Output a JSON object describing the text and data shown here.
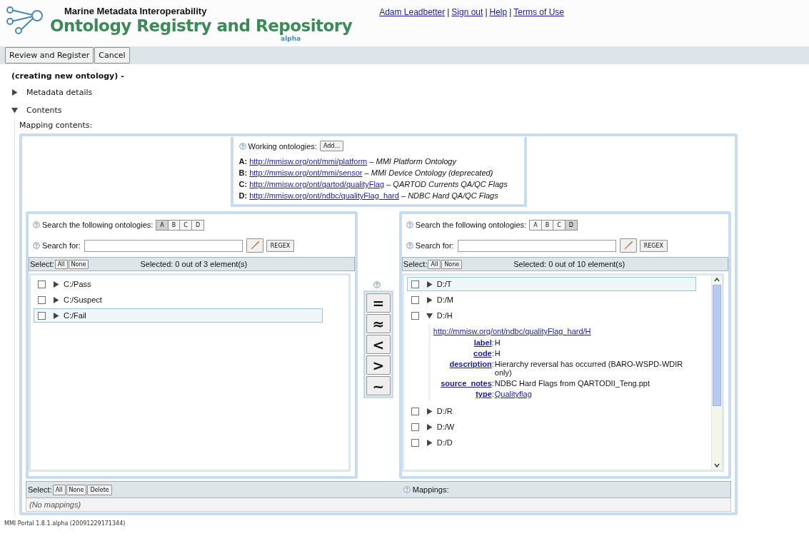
{
  "header": {
    "org": "Marine Metadata Interoperability",
    "title": "Ontology Registry and Repository",
    "badge": "alpha",
    "user_links": [
      "Adam Leadbetter",
      "Sign out",
      "Help",
      "Terms of Use"
    ],
    "link_separator": "|"
  },
  "toolbar": {
    "buttons": [
      "Review and Register",
      "Cancel"
    ]
  },
  "status": "(creating new ontology) -",
  "sections": [
    {
      "label": "Metadata details",
      "expanded": false
    },
    {
      "label": "Contents",
      "expanded": true
    }
  ],
  "mapping_label": "Mapping contents:",
  "working": {
    "label": "Working ontologies:",
    "add_button": "Add...",
    "dash": "–",
    "items": [
      {
        "letter": "A:",
        "url": "http://mmisw.org/ont/mmi/platform",
        "name": "MMI Platform Ontology"
      },
      {
        "letter": "B:",
        "url": "http://mmisw.org/ont/mmi/sensor",
        "name": "MMI Device Ontology (deprecated)"
      },
      {
        "letter": "C:",
        "url": "http://mmisw.org/ont/qartod/qualityFlag",
        "name": "QARTOD Currents QA/QC Flags"
      },
      {
        "letter": "D:",
        "url": "http://mmisw.org/ont/ndbc/qualityFlag_hard",
        "name": "NDBC Hard QA/QC Flags"
      }
    ]
  },
  "panels": [
    {
      "search_label": "Search the following ontologies:",
      "ontologies": [
        {
          "label": "A",
          "selected": true
        },
        {
          "label": "B",
          "selected": false
        },
        {
          "label": "C",
          "selected": false
        },
        {
          "label": "D",
          "selected": false
        }
      ],
      "search_for": "Search for:",
      "regex": "REGEX",
      "select_label": "Select:",
      "all": "All",
      "none": "None",
      "selected_text": "Selected: 0 out of 3 element(s)",
      "scrollbar": false,
      "rows": [
        {
          "label": "C:/Pass",
          "checked": false,
          "expanded": false,
          "highlighted": false
        },
        {
          "label": "C:/Suspect",
          "checked": false,
          "expanded": false,
          "highlighted": false
        },
        {
          "label": "C:/Fail",
          "checked": false,
          "expanded": false,
          "highlighted": true
        }
      ]
    },
    {
      "search_label": "Search the following ontologies:",
      "ontologies": [
        {
          "label": "A",
          "selected": false
        },
        {
          "label": "B",
          "selected": false
        },
        {
          "label": "C",
          "selected": false
        },
        {
          "label": "D",
          "selected": true
        }
      ],
      "search_for": "Search for:",
      "regex": "REGEX",
      "select_label": "Select:",
      "all": "All",
      "none": "None",
      "selected_text": "Selected: 0 out of 10 element(s)",
      "scrollbar": true,
      "rows": [
        {
          "label": "D:/T",
          "checked": false,
          "expanded": false,
          "highlighted": true
        },
        {
          "label": "D:/M",
          "checked": false,
          "expanded": false,
          "highlighted": false
        },
        {
          "label": "D:/H",
          "checked": false,
          "expanded": true,
          "highlighted": false,
          "details": {
            "colon": ":",
            "uri": "http://mmisw.org/ont/ndbc/qualityFlag_hard/H",
            "props": [
              {
                "key": "label",
                "value": "H",
                "link": false
              },
              {
                "key": "code",
                "value": "H",
                "link": false
              },
              {
                "key": "description",
                "value": "Hierarchy reversal has occurred (BARO-WSPD-WDIR only)",
                "link": false
              },
              {
                "key": "source_notes",
                "value": "NDBC Hard Flags from QARTODII_Teng.ppt",
                "link": false
              },
              {
                "key": "type",
                "value": "Qualityflag",
                "link": true
              }
            ]
          }
        },
        {
          "label": "D:/R",
          "checked": false,
          "expanded": false,
          "highlighted": false
        },
        {
          "label": "D:/W",
          "checked": false,
          "expanded": false,
          "highlighted": false
        },
        {
          "label": "D:/D",
          "checked": false,
          "expanded": false,
          "highlighted": false
        }
      ]
    }
  ],
  "relations": [
    "=",
    "≈",
    "<",
    ">",
    "~"
  ],
  "mappings": {
    "select_label": "Select:",
    "buttons": [
      "All",
      "None",
      "Delete"
    ],
    "label": "Mappings:",
    "empty": "(No mappings)"
  },
  "footer": "MMI Portal 1.8.1.alpha (20091229171344)"
}
